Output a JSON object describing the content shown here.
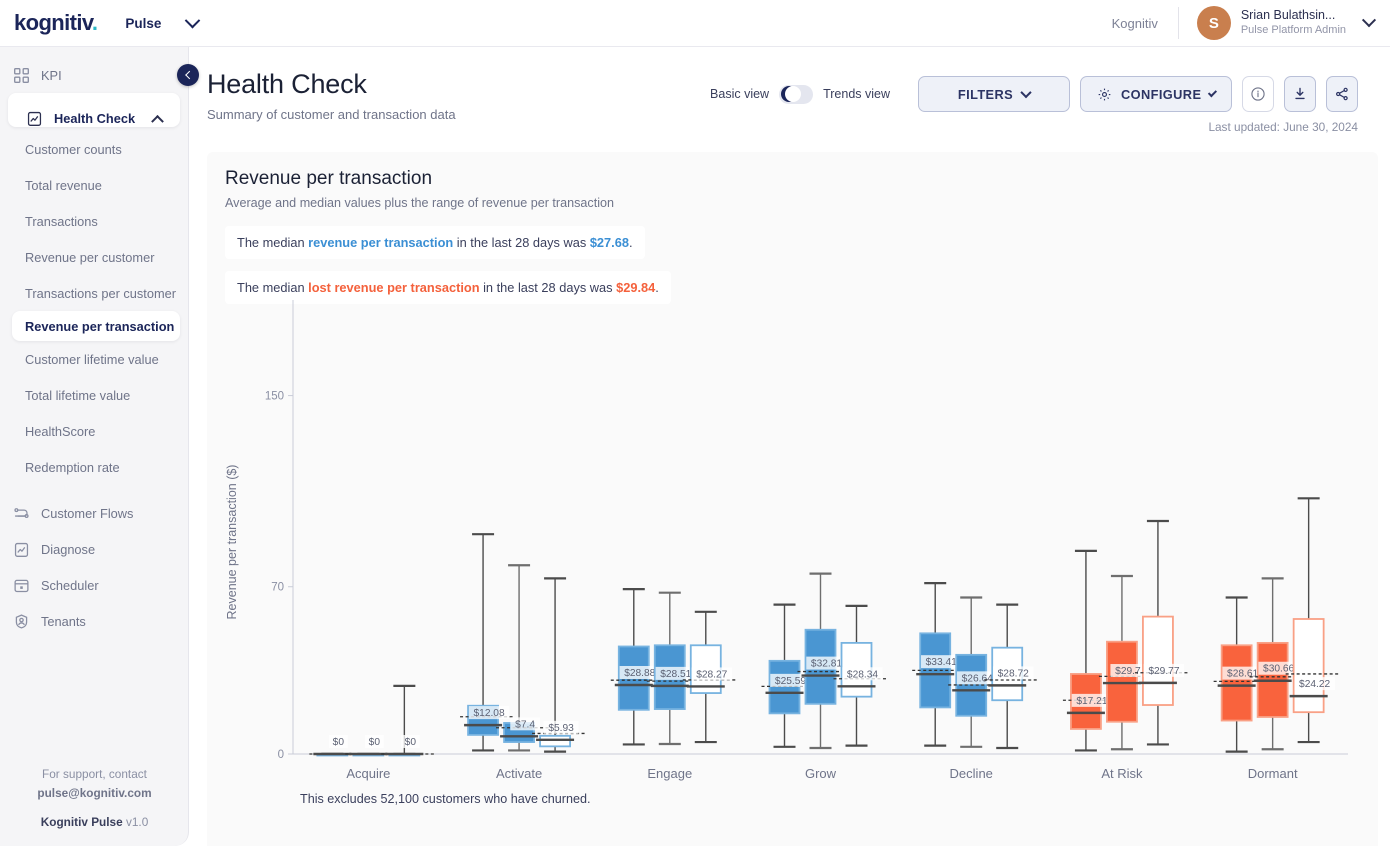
{
  "topbar": {
    "logo": "kognitiv",
    "product": "Pulse",
    "tenant": "Kognitiv",
    "user_initial": "S",
    "user_name": "Srian Bulathsin...",
    "user_role": "Pulse Platform Admin"
  },
  "sidebar": {
    "top_items": [
      {
        "label": "KPI",
        "icon": "grid-icon",
        "active": false
      },
      {
        "label": "Health Check",
        "icon": "clipboard-chart-icon",
        "active": true
      }
    ],
    "sub_items": [
      {
        "label": "Customer counts",
        "active": false
      },
      {
        "label": "Total revenue",
        "active": false
      },
      {
        "label": "Transactions",
        "active": false
      },
      {
        "label": "Revenue per customer",
        "active": false
      },
      {
        "label": "Transactions per customer",
        "active": false
      },
      {
        "label": "Revenue per transaction",
        "active": true
      },
      {
        "label": "Customer lifetime value",
        "active": false
      },
      {
        "label": "Total lifetime value",
        "active": false
      },
      {
        "label": "HealthScore",
        "active": false
      },
      {
        "label": "Redemption rate",
        "active": false
      }
    ],
    "bottom_items": [
      {
        "label": "Customer Flows",
        "icon": "flow-icon"
      },
      {
        "label": "Diagnose",
        "icon": "clipboard-chart-icon"
      },
      {
        "label": "Scheduler",
        "icon": "calendar-icon"
      },
      {
        "label": "Tenants",
        "icon": "shield-user-icon"
      }
    ],
    "footer": {
      "support_line": "For support, contact",
      "support_email": "pulse@kognitiv.com",
      "app_name": "Kognitiv Pulse",
      "version": "v1.0"
    }
  },
  "page": {
    "title": "Health Check",
    "subtitle": "Summary of customer and transaction data",
    "basic_view_label": "Basic view",
    "trends_view_label": "Trends view",
    "toggle_state": "basic",
    "filters_label": "FILTERS",
    "configure_label": "CONFIGURE",
    "last_updated": "Last updated: June 30, 2024"
  },
  "chart_card": {
    "title": "Revenue per transaction",
    "subtitle": "Average and median values plus the range of revenue per transaction",
    "callout_1": {
      "pre": "The median ",
      "highlight": "revenue per transaction",
      "mid": " in the last 28 days was ",
      "value": "$27.68",
      "post": ".",
      "color": "#3b8fd4"
    },
    "callout_2": {
      "pre": "The median ",
      "highlight": "lost revenue per transaction",
      "mid": " in the last 28 days was ",
      "value": "$29.84",
      "post": ".",
      "color": "#f4613c"
    },
    "footnote": "This excludes 52,100 customers who have churned."
  },
  "chart_data": {
    "type": "box",
    "title": "Revenue per transaction",
    "subtitle": "Average and median values plus the range of revenue per transaction",
    "xlabel": "",
    "ylabel": "Revenue per transaction ($)",
    "ylim": [
      0,
      190
    ],
    "yticks": [
      0,
      70,
      150
    ],
    "ytick_labels": [
      "0",
      "70",
      "150"
    ],
    "grid": false,
    "legend": null,
    "categories": [
      "Acquire",
      "Activate",
      "Engage",
      "Grow",
      "Decline",
      "At Risk",
      "Dormant"
    ],
    "colors": {
      "blue_fill": "#4a96d2",
      "blue_stroke": "#77b3e0",
      "red_fill": "#f9633d",
      "red_stroke": "#f9a085",
      "white_fill": "#ffffff",
      "whisker": "#4b4b4b",
      "whisker_alt": "#6e6e6e"
    },
    "series": [
      {
        "name": "Acquire",
        "color": "blue",
        "boxes": [
          {
            "variant": "filled-blue",
            "label": "$0",
            "min": 0,
            "q1": 0,
            "median": 0,
            "mean": 0,
            "q3": 0,
            "max": 0
          },
          {
            "variant": "filled-blue",
            "label": "$0",
            "min": 0,
            "q1": 0,
            "median": 0,
            "mean": 0,
            "q3": 0,
            "max": 0
          },
          {
            "variant": "outline-blue",
            "label": "$0",
            "min": 0,
            "q1": 0,
            "median": 0,
            "mean": 0,
            "q3": 0,
            "max": 28.5
          }
        ]
      },
      {
        "name": "Activate",
        "color": "blue",
        "boxes": [
          {
            "variant": "filled-blue",
            "label": "$12.08",
            "min": 1.5,
            "q1": 8.0,
            "median": 12.08,
            "mean": 15.6,
            "q3": 20.2,
            "max": 92.0
          },
          {
            "variant": "filled-blue",
            "label": "$7.4",
            "min": 1.5,
            "q1": 5.0,
            "median": 7.4,
            "mean": 11.0,
            "q3": 13.0,
            "max": 79.0
          },
          {
            "variant": "outline-blue",
            "label": "$5.93",
            "min": 1.0,
            "q1": 3.2,
            "median": 5.93,
            "mean": 8.6,
            "q3": 7.6,
            "max": 73.5
          }
        ]
      },
      {
        "name": "Engage",
        "color": "blue",
        "boxes": [
          {
            "variant": "filled-blue",
            "label": "$28.88",
            "min": 4.0,
            "q1": 18.5,
            "median": 28.88,
            "mean": 30.9,
            "q3": 45.0,
            "max": 69.0
          },
          {
            "variant": "filled-blue",
            "label": "$28.51",
            "min": 4.2,
            "q1": 18.8,
            "median": 28.51,
            "mean": 30.5,
            "q3": 45.5,
            "max": 67.5
          },
          {
            "variant": "outline-blue",
            "label": "$28.27",
            "min": 5.0,
            "q1": 25.5,
            "median": 28.27,
            "mean": 31.0,
            "q3": 45.5,
            "max": 59.5
          }
        ]
      },
      {
        "name": "Grow",
        "color": "blue",
        "boxes": [
          {
            "variant": "filled-blue",
            "label": "$25.59",
            "min": 3.0,
            "q1": 17.0,
            "median": 25.59,
            "mean": 28.3,
            "q3": 39.0,
            "max": 62.5
          },
          {
            "variant": "filled-blue",
            "label": "$32.81",
            "min": 2.5,
            "q1": 21.0,
            "median": 32.81,
            "mean": 34.5,
            "q3": 52.0,
            "max": 75.5
          },
          {
            "variant": "outline-blue",
            "label": "$28.34",
            "min": 3.5,
            "q1": 24.0,
            "median": 28.34,
            "mean": 31.5,
            "q3": 46.5,
            "max": 62.0
          }
        ]
      },
      {
        "name": "Decline",
        "color": "blue",
        "boxes": [
          {
            "variant": "filled-blue",
            "label": "$33.41",
            "min": 3.5,
            "q1": 19.5,
            "median": 33.41,
            "mean": 35.0,
            "q3": 50.5,
            "max": 71.5
          },
          {
            "variant": "filled-blue",
            "label": "$26.64",
            "min": 3.0,
            "q1": 16.0,
            "median": 26.64,
            "mean": 28.9,
            "q3": 41.5,
            "max": 65.5
          },
          {
            "variant": "outline-blue",
            "label": "$28.72",
            "min": 2.5,
            "q1": 22.5,
            "median": 28.72,
            "mean": 31.0,
            "q3": 44.5,
            "max": 62.5
          }
        ]
      },
      {
        "name": "At Risk",
        "color": "red",
        "boxes": [
          {
            "variant": "filled-red",
            "label": "$17.21",
            "min": 1.5,
            "q1": 10.5,
            "median": 17.21,
            "mean": 22.5,
            "q3": 33.5,
            "max": 85.0
          },
          {
            "variant": "filled-red",
            "label": "$29.7",
            "min": 2.0,
            "q1": 13.5,
            "median": 29.7,
            "mean": 32.5,
            "q3": 47.0,
            "max": 74.5
          },
          {
            "variant": "outline-red",
            "label": "$29.77",
            "min": 4.0,
            "q1": 20.5,
            "median": 29.77,
            "mean": 34.0,
            "q3": 57.5,
            "max": 97.5
          }
        ]
      },
      {
        "name": "Dormant",
        "color": "red",
        "boxes": [
          {
            "variant": "filled-red",
            "label": "$28.61",
            "min": 1.0,
            "q1": 14.0,
            "median": 28.61,
            "mean": 30.4,
            "q3": 45.5,
            "max": 65.5
          },
          {
            "variant": "filled-red",
            "label": "$30.66",
            "min": 2.0,
            "q1": 15.5,
            "median": 30.66,
            "mean": 32.3,
            "q3": 46.5,
            "max": 73.5
          },
          {
            "variant": "outline-red",
            "label": "$24.22",
            "min": 5.0,
            "q1": 17.5,
            "median": 24.22,
            "mean": 33.5,
            "q3": 56.5,
            "max": 107.0
          }
        ]
      }
    ]
  }
}
